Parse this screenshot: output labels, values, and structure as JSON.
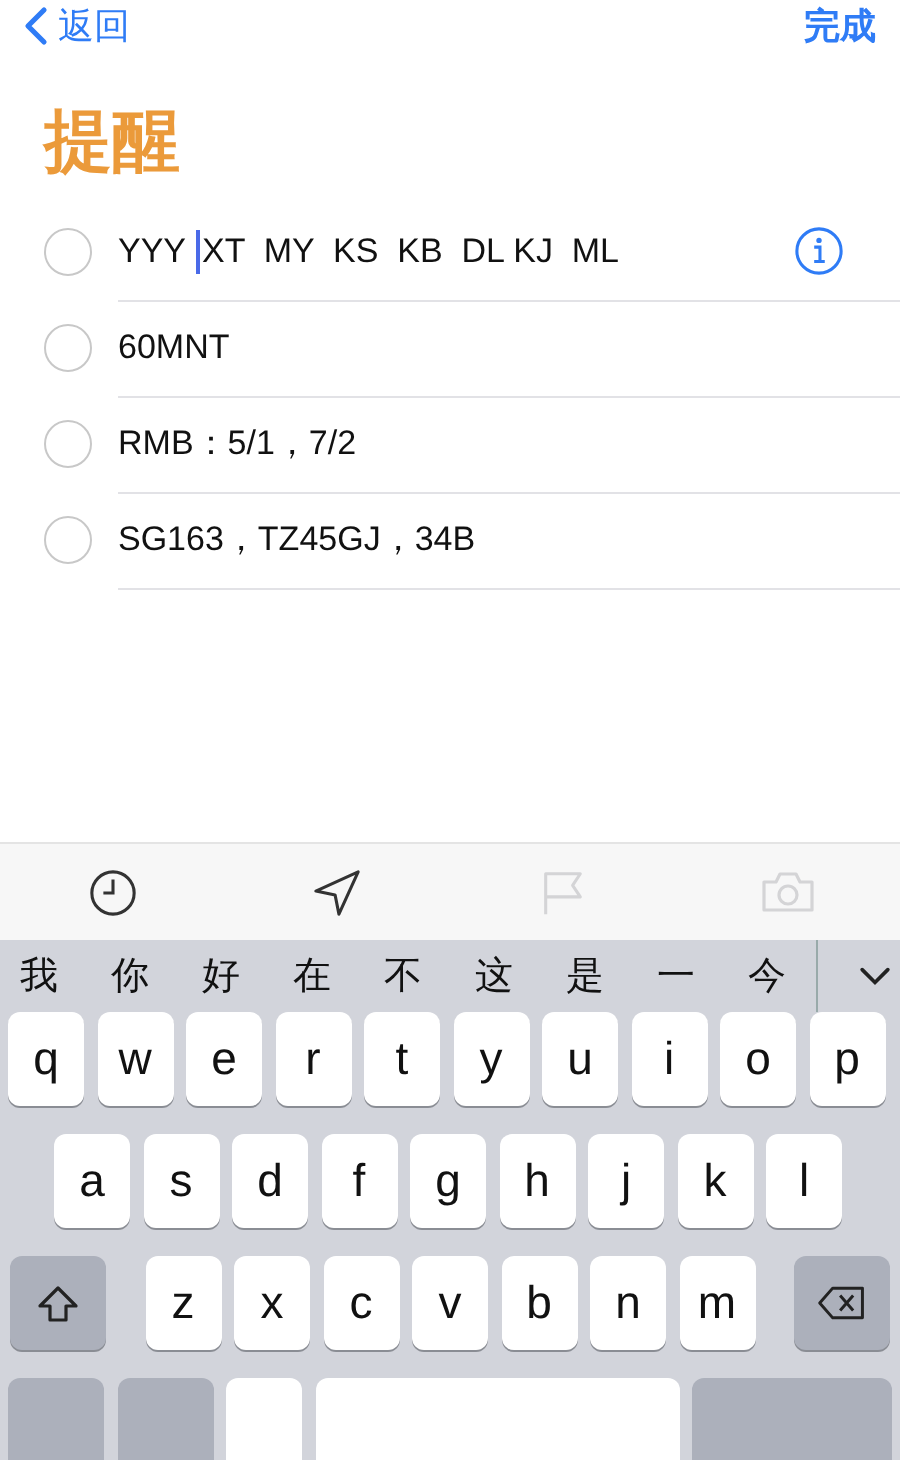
{
  "nav": {
    "back": "返回",
    "done": "完成"
  },
  "title": "提醒",
  "reminders": [
    {
      "kind": "editing",
      "text": "YYY",
      "text_after_caret": "XT  MY  KS  KB  DL KJ  ML",
      "checked": false
    },
    {
      "kind": "plain",
      "text": "60MNT",
      "checked": false
    },
    {
      "kind": "plain",
      "text": "RMB：5/1，7/2",
      "checked": false
    },
    {
      "kind": "plain",
      "text": "SG163，TZ45GJ，34B",
      "checked": false
    }
  ],
  "toolbar": [
    {
      "kind": "clock",
      "disabled": false
    },
    {
      "kind": "location",
      "disabled": false
    },
    {
      "kind": "flag",
      "disabled": true
    },
    {
      "kind": "camera",
      "disabled": true
    }
  ],
  "candidates": [
    "我",
    "你",
    "好",
    "在",
    "不",
    "这",
    "是",
    "一",
    "今"
  ],
  "keyboard": {
    "rows": [
      [
        "q",
        "w",
        "e",
        "r",
        "t",
        "y",
        "u",
        "i",
        "o",
        "p"
      ],
      [
        "a",
        "s",
        "d",
        "f",
        "g",
        "h",
        "j",
        "k",
        "l"
      ],
      [
        "z",
        "x",
        "c",
        "v",
        "b",
        "n",
        "m"
      ]
    ]
  }
}
